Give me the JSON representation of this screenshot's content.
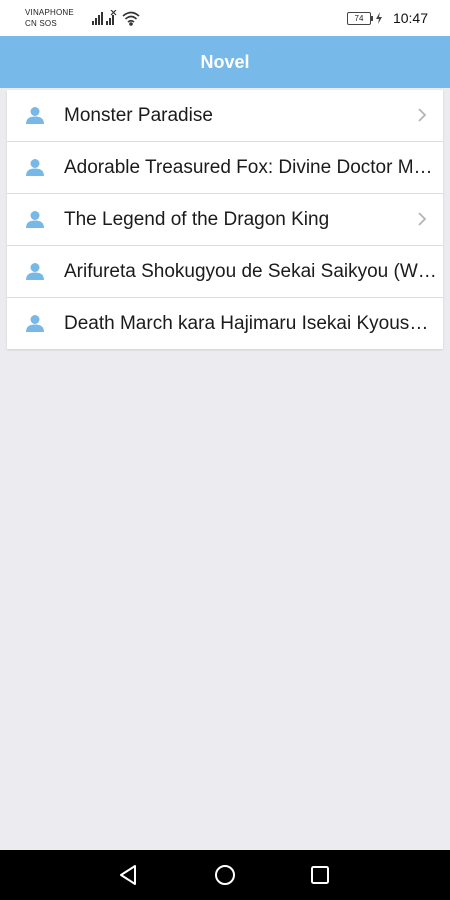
{
  "status_bar": {
    "carrier_line1": "VINAPHONE",
    "carrier_line2": "CN SOS",
    "battery": "74",
    "time": "10:47"
  },
  "header": {
    "title": "Novel"
  },
  "novels": [
    {
      "title": "Monster Paradise",
      "chevron": true
    },
    {
      "title": "Adorable Treasured Fox: Divine Doctor Mother Overturning the Heavens!",
      "chevron": false
    },
    {
      "title": "The Legend of the Dragon King",
      "chevron": true
    },
    {
      "title": "Arifureta Shokugyou de Sekai Saikyou (WN)",
      "chevron": false
    },
    {
      "title": "Death March kara Hajimaru Isekai Kyousoukyoku",
      "chevron": false
    }
  ],
  "colors": {
    "header_bg": "#77b9e8",
    "icon_blue": "#78b8e6",
    "page_bg": "#ececf0"
  },
  "icons": {
    "list_item": "user-icon",
    "row_arrow": "chevron-right-icon",
    "nav_back": "back-triangle-icon",
    "nav_home": "home-circle-icon",
    "nav_recents": "recents-square-icon"
  }
}
